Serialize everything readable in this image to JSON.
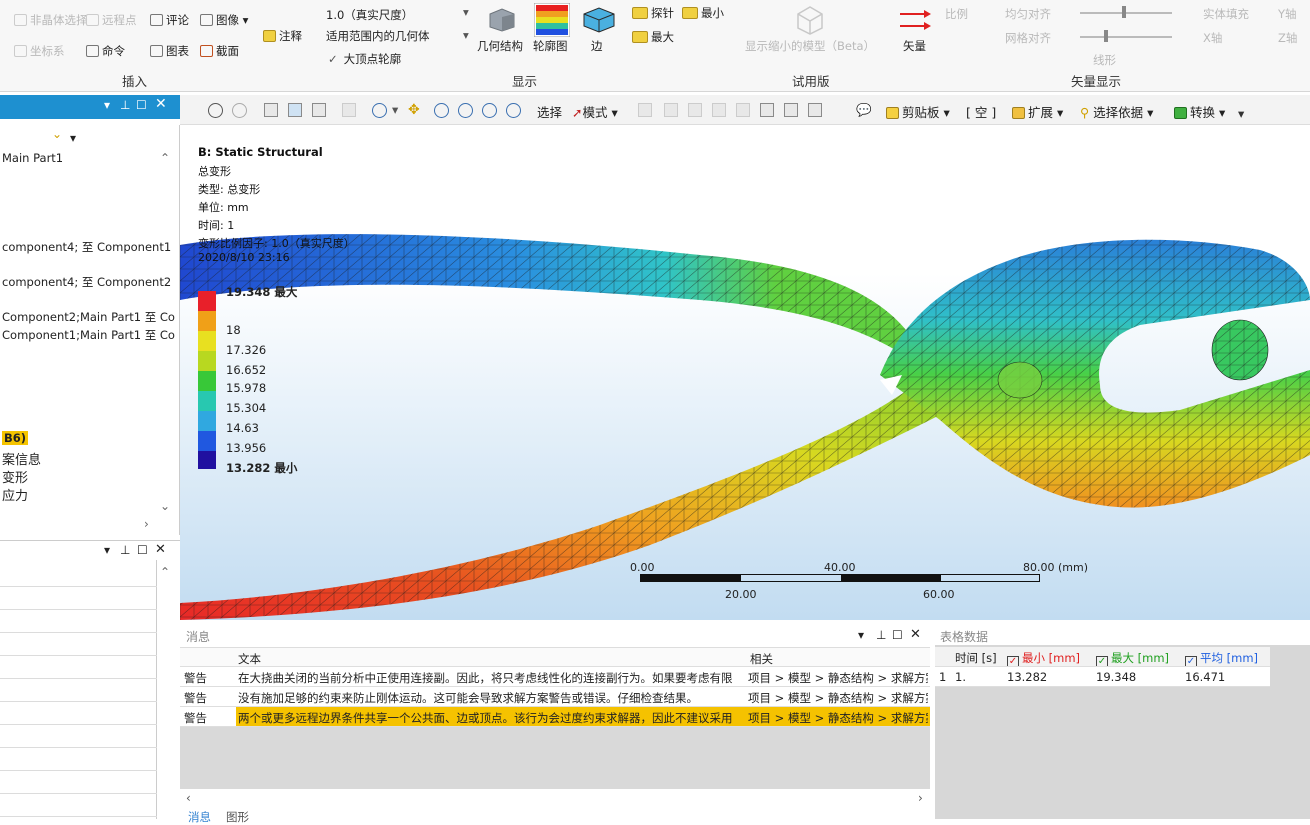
{
  "ribbon": {
    "insert": {
      "items": [
        "非晶体选择",
        "远程点",
        "评论",
        "图像",
        "坐标系",
        "命令",
        "图表",
        "截面",
        "注释"
      ],
      "group_label": "插入"
    },
    "display": {
      "scale_value": "1.0（真实尺度）",
      "scope_label": "适用范围内的几何体",
      "outline_label": "大顶点轮廓",
      "geometry_label": "几何结构",
      "contour_label": "轮廓图",
      "edge_label": "边",
      "probe_label": "探针",
      "min_label": "最小",
      "max_label": "最大",
      "group_label": "显示"
    },
    "trial": {
      "item": "显示缩小的模型（Beta）",
      "group_label": "试用版"
    },
    "vector": {
      "vector_label": "矢量",
      "items": [
        "比例",
        "均匀对齐",
        "网格对齐",
        "实体填充",
        "Y轴",
        "X轴",
        "Z轴",
        "线形"
      ],
      "group_label": "矢量显示"
    }
  },
  "toolbar": {
    "select_label": "选择",
    "mode_label": "模式",
    "clipboard_label": "剪贴板",
    "empty_label": "[ 空 ]",
    "extend_label": "扩展",
    "select_by_label": "选择依据",
    "convert_label": "转换"
  },
  "tree": {
    "items": [
      "Main Part1",
      "component4; 至 Component1",
      "component4; 至 Component2",
      "Component2;Main Part1 至 Co",
      "Component1;Main Part1 至 Co",
      "B6)",
      "案信息",
      "变形",
      "应力"
    ]
  },
  "viewport": {
    "header": {
      "title": "B: Static Structural",
      "result_name": "总变形",
      "type_line": "类型: 总变形",
      "unit_line": "单位: mm",
      "time_line": "时间: 1",
      "scale_line": "变形比例因子: 1.0（真实尺度）",
      "date_line": "2020/8/10 23:16"
    },
    "legend": {
      "max_label": "19.348 最大",
      "values": [
        "18",
        "17.326",
        "16.652",
        "15.978",
        "15.304",
        "14.63",
        "13.956"
      ],
      "min_label": "13.282 最小",
      "colors": [
        "#e8202a",
        "#f0a018",
        "#e8e020",
        "#b8d820",
        "#38c838",
        "#28c8b0",
        "#30a8e0",
        "#2058e0",
        "#2010a0"
      ]
    },
    "scale_bar": {
      "top_labels": [
        "0.00",
        "40.00",
        "80.00 (mm)"
      ],
      "bottom_labels": [
        "20.00",
        "60.00"
      ]
    }
  },
  "messages": {
    "panel_title": "消息",
    "columns": [
      "文本",
      "相关"
    ],
    "rows": [
      {
        "type": "警告",
        "text": "在大挠曲关闭的当前分析中正使用连接副。因此，将只考虑线性化的连接副行为。如果要考虑有限",
        "related": "项目 > 模型 > 静态结构 > 求解方案"
      },
      {
        "type": "警告",
        "text": "没有施加足够的约束来防止刚体运动。这可能会导致求解方案警告或错误。仔细检查结果。",
        "related": "项目 > 模型 > 静态结构 > 求解方案"
      },
      {
        "type": "警告",
        "text": "两个或更多远程边界条件共享一个公共面、边或顶点。该行为会过度约束求解器，因此不建议采用",
        "related": "项目 > 模型 > 静态结构 > 求解方案"
      }
    ],
    "tabs": [
      "消息",
      "图形"
    ]
  },
  "table": {
    "panel_title": "表格数据",
    "headers": [
      "时间 [s]",
      "最小 [mm]",
      "最大 [mm]",
      "平均 [mm]"
    ],
    "header_colors": [
      "#222222",
      "#e02020",
      "#20a020",
      "#2060e0"
    ],
    "rows": [
      [
        "1",
        "1.",
        "13.282",
        "19.348",
        "16.471"
      ]
    ]
  }
}
